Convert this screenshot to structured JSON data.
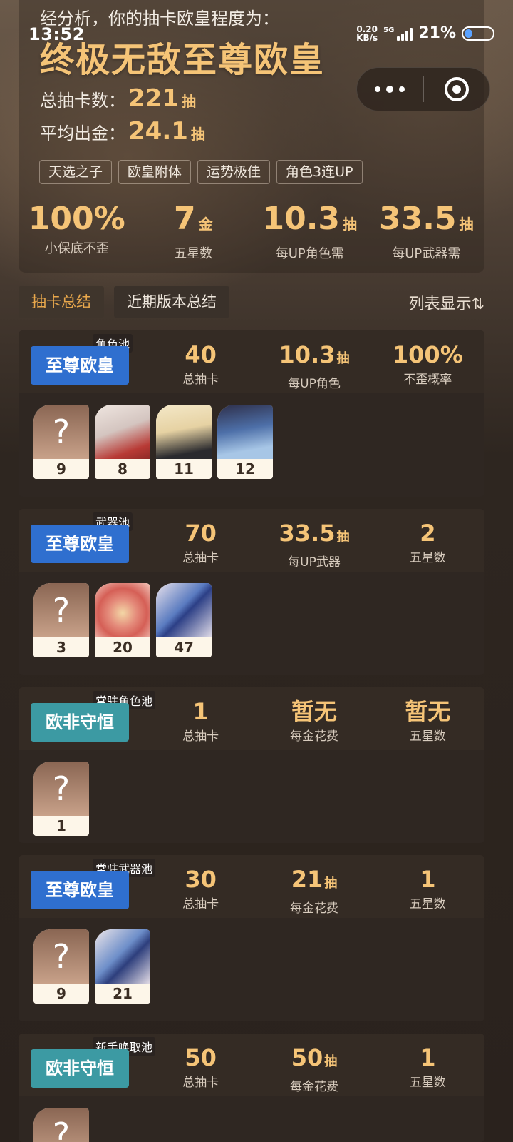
{
  "status": {
    "time": "13:52",
    "net_speed_top": "0.20",
    "net_speed_bottom": "KB/s",
    "signal": "5G",
    "battery": "21%"
  },
  "header": {
    "intro": "经分析，你的抽卡欧皇程度为：",
    "rank_title": "终极无敌至尊欧皇",
    "total_label": "总抽卡数：",
    "total_value": "221",
    "total_unit": "抽",
    "avg_label": "平均出金：",
    "avg_value": "24.1",
    "avg_unit": "抽",
    "tags": [
      "天选之子",
      "欧皇附体",
      "运势极佳",
      "角色3连UP"
    ],
    "big_stats": [
      {
        "value": "100%",
        "unit": "",
        "label": "小保底不歪"
      },
      {
        "value": "7",
        "unit": "金",
        "label": "五星数"
      },
      {
        "value": "10.3",
        "unit": "抽",
        "label": "每UP角色需"
      },
      {
        "value": "33.5",
        "unit": "抽",
        "label": "每UP武器需"
      }
    ]
  },
  "tabs": [
    "抽卡总结",
    "近期版本总结"
  ],
  "list_toggle": "列表显示⇅",
  "pools": [
    {
      "type": "角色池",
      "rank": "至尊欧皇",
      "color": "blue",
      "stats": [
        {
          "v": "40",
          "u": "",
          "l": "总抽卡"
        },
        {
          "v": "10.3",
          "u": "抽",
          "l": "每UP角色"
        },
        {
          "v": "100%",
          "u": "",
          "l": "不歪概率"
        }
      ],
      "cards": [
        {
          "art": "unknown",
          "count": "9"
        },
        {
          "art": "c1",
          "count": "8"
        },
        {
          "art": "c2",
          "count": "11"
        },
        {
          "art": "c3",
          "count": "12"
        }
      ]
    },
    {
      "type": "武器池",
      "rank": "至尊欧皇",
      "color": "blue",
      "stats": [
        {
          "v": "70",
          "u": "",
          "l": "总抽卡"
        },
        {
          "v": "33.5",
          "u": "抽",
          "l": "每UP武器"
        },
        {
          "v": "2",
          "u": "",
          "l": "五星数"
        }
      ],
      "cards": [
        {
          "art": "unknown",
          "count": "3"
        },
        {
          "art": "w1",
          "count": "20"
        },
        {
          "art": "w2",
          "count": "47"
        }
      ]
    },
    {
      "type": "常驻角色池",
      "rank": "欧非守恒",
      "color": "teal",
      "stats": [
        {
          "v": "1",
          "u": "",
          "l": "总抽卡"
        },
        {
          "v": "暂无",
          "u": "",
          "l": "每金花费"
        },
        {
          "v": "暂无",
          "u": "",
          "l": "五星数"
        }
      ],
      "cards": [
        {
          "art": "unknown",
          "count": "1"
        }
      ]
    },
    {
      "type": "常驻武器池",
      "rank": "至尊欧皇",
      "color": "blue",
      "stats": [
        {
          "v": "30",
          "u": "",
          "l": "总抽卡"
        },
        {
          "v": "21",
          "u": "抽",
          "l": "每金花费"
        },
        {
          "v": "1",
          "u": "",
          "l": "五星数"
        }
      ],
      "cards": [
        {
          "art": "unknown",
          "count": "9"
        },
        {
          "art": "w3",
          "count": "21"
        }
      ]
    },
    {
      "type": "新手唤取池",
      "rank": "欧非守恒",
      "color": "teal",
      "stats": [
        {
          "v": "50",
          "u": "",
          "l": "总抽卡"
        },
        {
          "v": "50",
          "u": "抽",
          "l": "每金花费"
        },
        {
          "v": "1",
          "u": "",
          "l": "五星数"
        }
      ],
      "cards": [
        {
          "art": "unknown",
          "count": ""
        }
      ]
    }
  ]
}
